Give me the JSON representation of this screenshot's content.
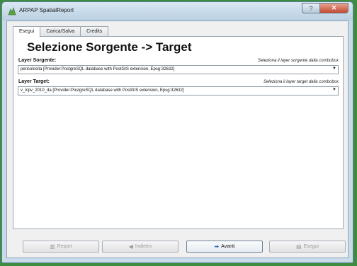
{
  "window": {
    "title": "ARPAP SpatialReport"
  },
  "title_controls": {
    "help": "?",
    "close": "✕"
  },
  "tabs": [
    {
      "label": "Esegui",
      "active": true
    },
    {
      "label": "Carica/Salva",
      "active": false
    },
    {
      "label": "Credits",
      "active": false
    }
  ],
  "main": {
    "heading": "Selezione Sorgente -> Target",
    "source": {
      "label": "Layer Sorgente:",
      "hint": "Seleziona il layer sorgente dalla combobox",
      "value": "pericolosita [Provider:PostgreSQL database with PostGIS extension, Epsg:32632]"
    },
    "target": {
      "label": "Layer Target:",
      "hint": "Seleziona il layer target dalla combobox",
      "value": "v_lcpv_2010_da [Provider:PostgreSQL database with PostGIS extension, Epsg:32632]"
    }
  },
  "buttons": {
    "report": "Report",
    "back": "Indietro",
    "next": "Avanti",
    "run": "Esegui"
  },
  "colors": {
    "desktop": "#3e8c3f",
    "frame": "#c9dbe9",
    "accent": "#2a6bb8"
  }
}
